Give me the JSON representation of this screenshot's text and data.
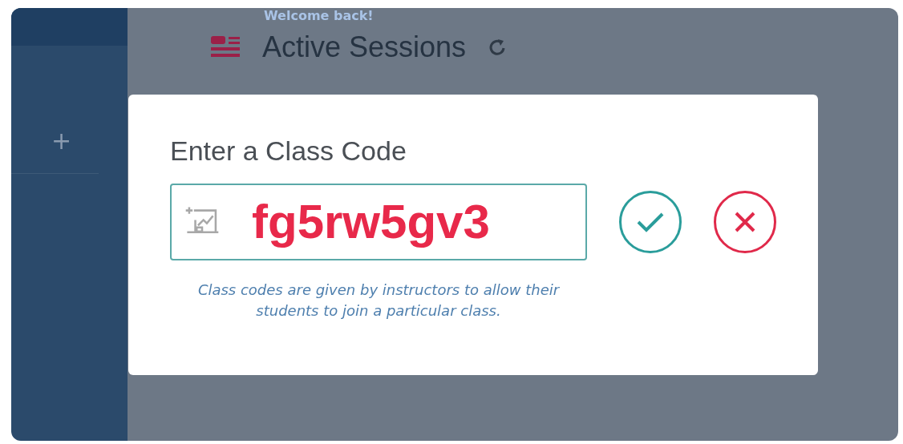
{
  "sidebar": {
    "add_label": "+"
  },
  "header": {
    "greeting": "Welcome back!",
    "title": "Active Sessions"
  },
  "dialog": {
    "title": "Enter a Class Code",
    "code": "fg5rw5gv3",
    "hint": "Class codes are given by instructors to allow their students to join a particular class."
  }
}
